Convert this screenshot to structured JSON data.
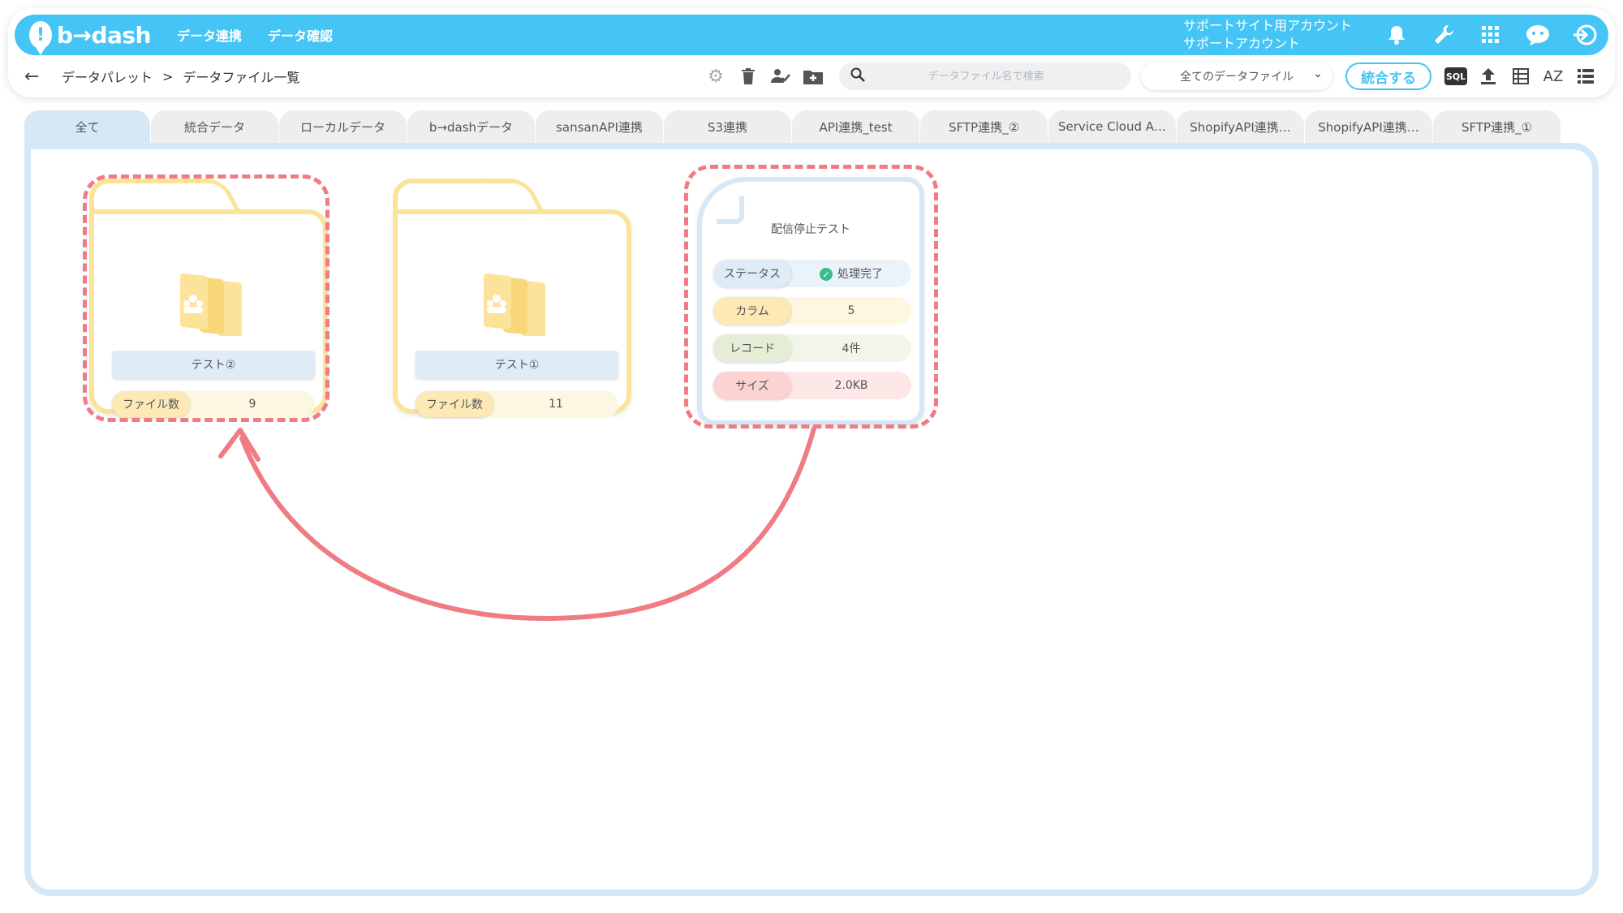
{
  "app": {
    "logo_text": "b→dash",
    "nav": [
      "データ連携",
      "データ確認"
    ],
    "account_line1": "サポートサイト用アカウント",
    "account_line2": "サポートアカウント",
    "top_icons": [
      "bell-icon",
      "wrench-icon",
      "apps-grid-icon",
      "chat-robot-icon",
      "logout-icon"
    ]
  },
  "breadcrumb": {
    "root": "データパレット",
    "separator": ">",
    "current": "データファイル一覧"
  },
  "toolbar": {
    "search_placeholder": "データファイル名で検索",
    "filter_selected": "全てのデータファイル",
    "merge_label": "統合する",
    "sql_label": "SQL",
    "sort_label": "AZ"
  },
  "tabs": [
    "全て",
    "統合データ",
    "ローカルデータ",
    "b→dashデータ",
    "sansanAPI連携",
    "S3連携",
    "API連携_test",
    "SFTP連携_②",
    "Service Cloud A…",
    "ShopifyAPI連携…",
    "ShopifyAPI連携…",
    "SFTP連携_①"
  ],
  "folders": [
    {
      "name": "テスト②",
      "count_label": "ファイル数",
      "count": "9"
    },
    {
      "name": "テスト①",
      "count_label": "ファイル数",
      "count": "11"
    }
  ],
  "file": {
    "name": "配信停止テスト",
    "status_label": "ステータス",
    "status_value": "処理完了",
    "columns_label": "カラム",
    "columns_value": "5",
    "records_label": "レコード",
    "records_value": "4件",
    "size_label": "サイズ",
    "size_value": "2.0KB"
  },
  "colors": {
    "primary": "#45c5f5",
    "folder_border": "#fbe39a",
    "panel_border": "#d6e7f5",
    "highlight": "#f07b82",
    "status_ok": "#3dbb8f"
  }
}
